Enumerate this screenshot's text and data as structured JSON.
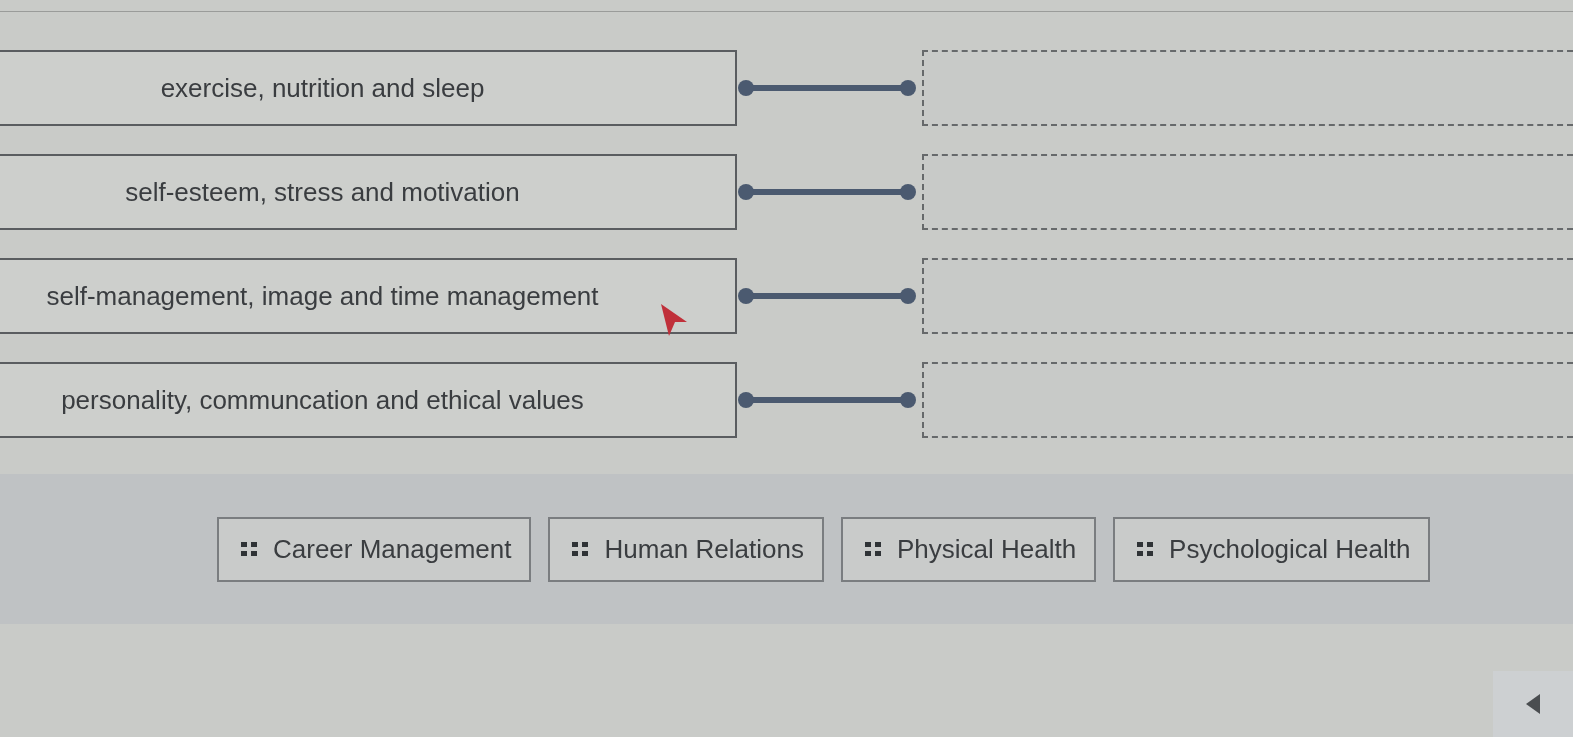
{
  "matches": [
    {
      "prompt": "exercise, nutrition and sleep"
    },
    {
      "prompt": "self-esteem, stress and motivation"
    },
    {
      "prompt": "self-management, image and time management"
    },
    {
      "prompt": "personality, communcation and ethical values"
    }
  ],
  "options": [
    {
      "label": "Career Management"
    },
    {
      "label": "Human Relations"
    },
    {
      "label": "Physical Health"
    },
    {
      "label": "Psychological Health"
    }
  ]
}
